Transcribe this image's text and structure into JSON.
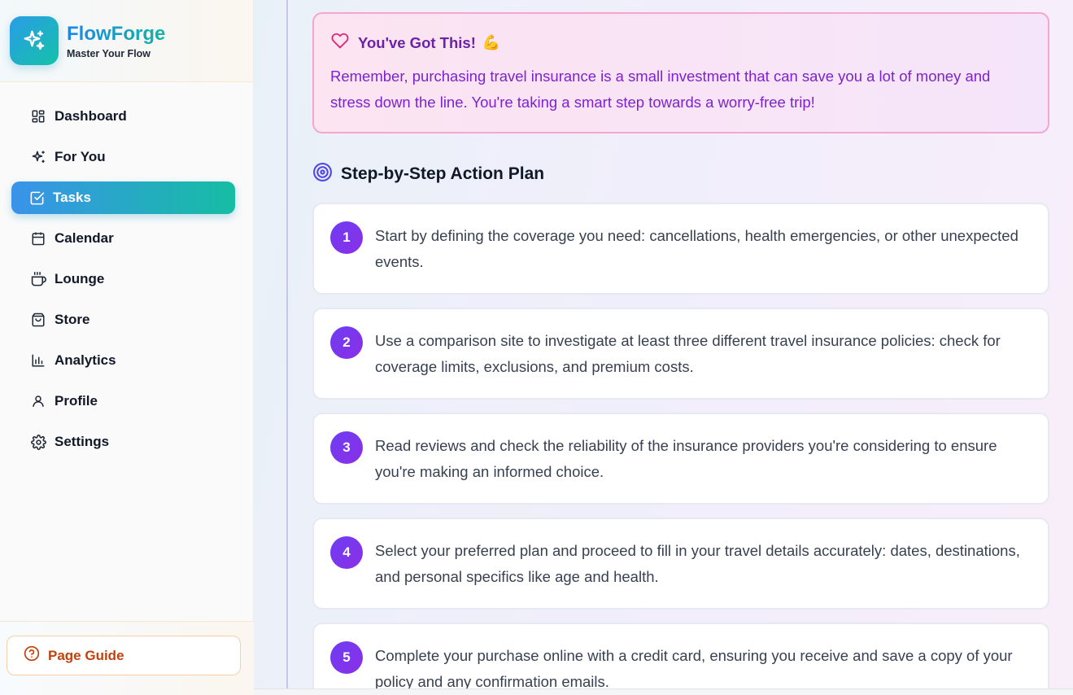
{
  "brand": {
    "name": "FlowForge",
    "tagline": "Master Your Flow",
    "icon": "sparkles-icon"
  },
  "sidebar": {
    "items": [
      {
        "label": "Dashboard",
        "icon": "grid-icon",
        "active": false
      },
      {
        "label": "For You",
        "icon": "sparkles-icon",
        "active": false
      },
      {
        "label": "Tasks",
        "icon": "check-square-icon",
        "active": true
      },
      {
        "label": "Calendar",
        "icon": "calendar-icon",
        "active": false
      },
      {
        "label": "Lounge",
        "icon": "coffee-icon",
        "active": false
      },
      {
        "label": "Store",
        "icon": "shopping-bag-icon",
        "active": false
      },
      {
        "label": "Analytics",
        "icon": "bar-chart-icon",
        "active": false
      },
      {
        "label": "Profile",
        "icon": "user-icon",
        "active": false
      },
      {
        "label": "Settings",
        "icon": "gear-icon",
        "active": false
      }
    ],
    "guide_label": "Page Guide"
  },
  "encouragement": {
    "title": "You've Got This!",
    "emoji": "💪",
    "body": "Remember, purchasing travel insurance is a small investment that can save you a lot of money and stress down the line. You're taking a smart step towards a worry-free trip!"
  },
  "plan": {
    "title": "Step-by-Step Action Plan",
    "steps": [
      {
        "number": "1",
        "text": "Start by defining the coverage you need: cancellations, health emergencies, or other unexpected events."
      },
      {
        "number": "2",
        "text": "Use a comparison site to investigate at least three different travel insurance policies: check for coverage limits, exclusions, and premium costs."
      },
      {
        "number": "3",
        "text": "Read reviews and check the reliability of the insurance providers you're considering to ensure you're making an informed choice."
      },
      {
        "number": "4",
        "text": "Select your preferred plan and proceed to fill in your travel details accurately: dates, destinations, and personal specifics like age and health."
      },
      {
        "number": "5",
        "text": "Complete your purchase online with a credit card, ensuring you receive and save a copy of your policy and any confirmation emails."
      }
    ]
  },
  "colors": {
    "accent_start": "#3a93ea",
    "accent_end": "#16bda3",
    "step_badge": "#6d3df2",
    "encourage_border": "#f4a6cf",
    "guide_text": "#c2410c"
  }
}
